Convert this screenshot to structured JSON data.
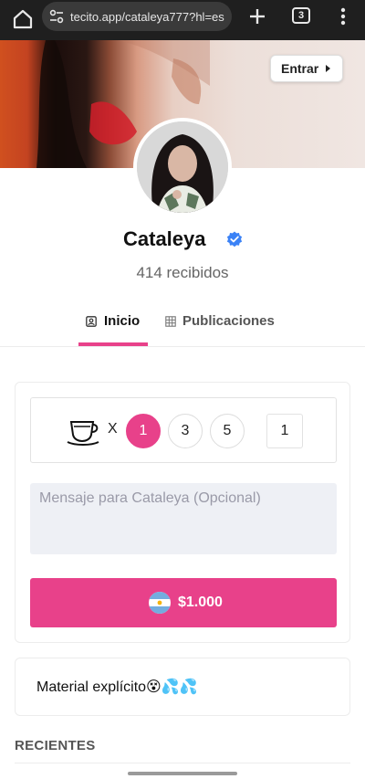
{
  "browser": {
    "url": "tecito.app/cataleya777?hl=es",
    "tab_count": "3"
  },
  "header": {
    "login_label": "Entrar"
  },
  "profile": {
    "name": "Cataleya",
    "received": "414 recibidos"
  },
  "tabs": [
    {
      "label": "Inicio",
      "active": true
    },
    {
      "label": "Publicaciones",
      "active": false
    }
  ],
  "donation": {
    "times_symbol": "X",
    "options": [
      "1",
      "3",
      "5"
    ],
    "selected_option": "1",
    "quantity_value": "1",
    "message_placeholder": "Mensaje para Cataleya (Opcional)",
    "pay_label": "$1.000"
  },
  "description": {
    "text": "Material explícito😵💦💦"
  },
  "recent": {
    "title": "RECIENTES"
  },
  "colors": {
    "accent": "#e8418a",
    "verified": "#3b82f6",
    "chrome_bg": "#1f1f1f"
  }
}
